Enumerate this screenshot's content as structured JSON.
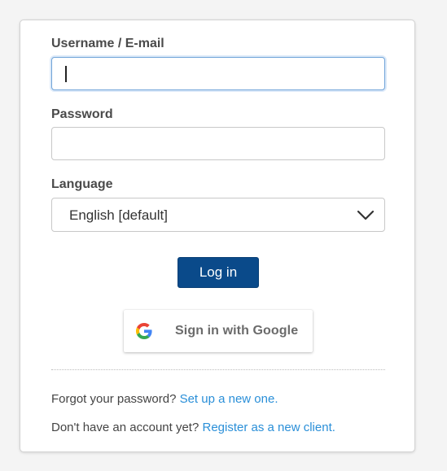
{
  "form": {
    "username_label": "Username / E-mail",
    "username_value": "",
    "password_label": "Password",
    "password_value": "",
    "language_label": "Language",
    "language_selected": "English [default]",
    "login_label": "Log in",
    "google_label": "Sign in with Google"
  },
  "footer": {
    "forgot_text": "Forgot your password?",
    "forgot_link": "Set up a new one.",
    "register_text": "Don't have an account yet?",
    "register_link": "Register as a new client."
  },
  "colors": {
    "primary_button": "#0a4a8a",
    "link": "#2a8fd8",
    "focus_border": "#6fa3d8"
  },
  "icons": {
    "google": "google-g-logo-icon",
    "dropdown": "chevron-down-icon"
  }
}
